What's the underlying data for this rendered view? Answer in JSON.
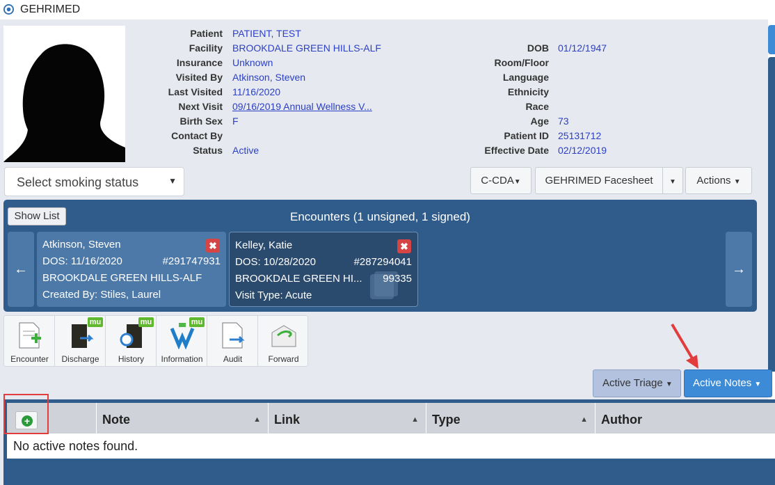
{
  "window": {
    "title": "GEHRIMED"
  },
  "patient": {
    "left": [
      {
        "label": "Patient",
        "value": "PATIENT, TEST"
      },
      {
        "label": "Facility",
        "value": "BROOKDALE GREEN HILLS-ALF"
      },
      {
        "label": "Insurance",
        "value": "Unknown"
      },
      {
        "label": "Visited By",
        "value": "Atkinson, Steven"
      },
      {
        "label": "Last Visited",
        "value": "11/16/2020"
      },
      {
        "label": "Next Visit",
        "value": "09/16/2019 Annual Wellness V..."
      },
      {
        "label": "Birth Sex",
        "value": "F"
      },
      {
        "label": "Contact By",
        "value": ""
      },
      {
        "label": "Status",
        "value": "Active"
      }
    ],
    "right": [
      {
        "label": "DOB",
        "value": "01/12/1947"
      },
      {
        "label": "Room/Floor",
        "value": ""
      },
      {
        "label": "Language",
        "value": ""
      },
      {
        "label": "Ethnicity",
        "value": ""
      },
      {
        "label": "Race",
        "value": ""
      },
      {
        "label": "Age",
        "value": "73"
      },
      {
        "label": "Patient ID",
        "value": "25131712"
      },
      {
        "label": "Effective Date",
        "value": "02/12/2019"
      }
    ]
  },
  "smoking": {
    "placeholder": "Select smoking status"
  },
  "actions": {
    "ccda": "C-CDA",
    "facesheet": "GEHRIMED Facesheet",
    "actions": "Actions"
  },
  "encounters": {
    "show_list": "Show List",
    "title": "Encounters (1 unsigned, 1 signed)",
    "cards": [
      {
        "name": "Atkinson, Steven",
        "dos": "DOS: 11/16/2020",
        "num": "#291747931",
        "facility": "BROOKDALE GREEN HILLS-ALF",
        "extra": "Created By: Stiles, Laurel",
        "code": ""
      },
      {
        "name": "Kelley, Katie",
        "dos": "DOS: 10/28/2020",
        "num": "#287294041",
        "facility": "BROOKDALE GREEN HI...",
        "extra": "Visit Type: Acute",
        "code": "99335"
      }
    ]
  },
  "toolbar": {
    "items": [
      {
        "label": "Encounter",
        "mu": ""
      },
      {
        "label": "Discharge",
        "mu": "mu"
      },
      {
        "label": "History",
        "mu": "mu"
      },
      {
        "label": "Information",
        "mu": "mu"
      },
      {
        "label": "Audit",
        "mu": ""
      },
      {
        "label": "Forward",
        "mu": ""
      }
    ]
  },
  "filters": {
    "triage": "Active Triage",
    "notes": "Active Notes"
  },
  "notes_table": {
    "columns": [
      "Note",
      "Link",
      "Type",
      "Author"
    ],
    "empty": "No active notes found."
  },
  "colors": {
    "panel": "#2f5c8a",
    "link": "#2b3fc4",
    "accent": "#3d8ad6",
    "annotation": "#e23c3c"
  }
}
